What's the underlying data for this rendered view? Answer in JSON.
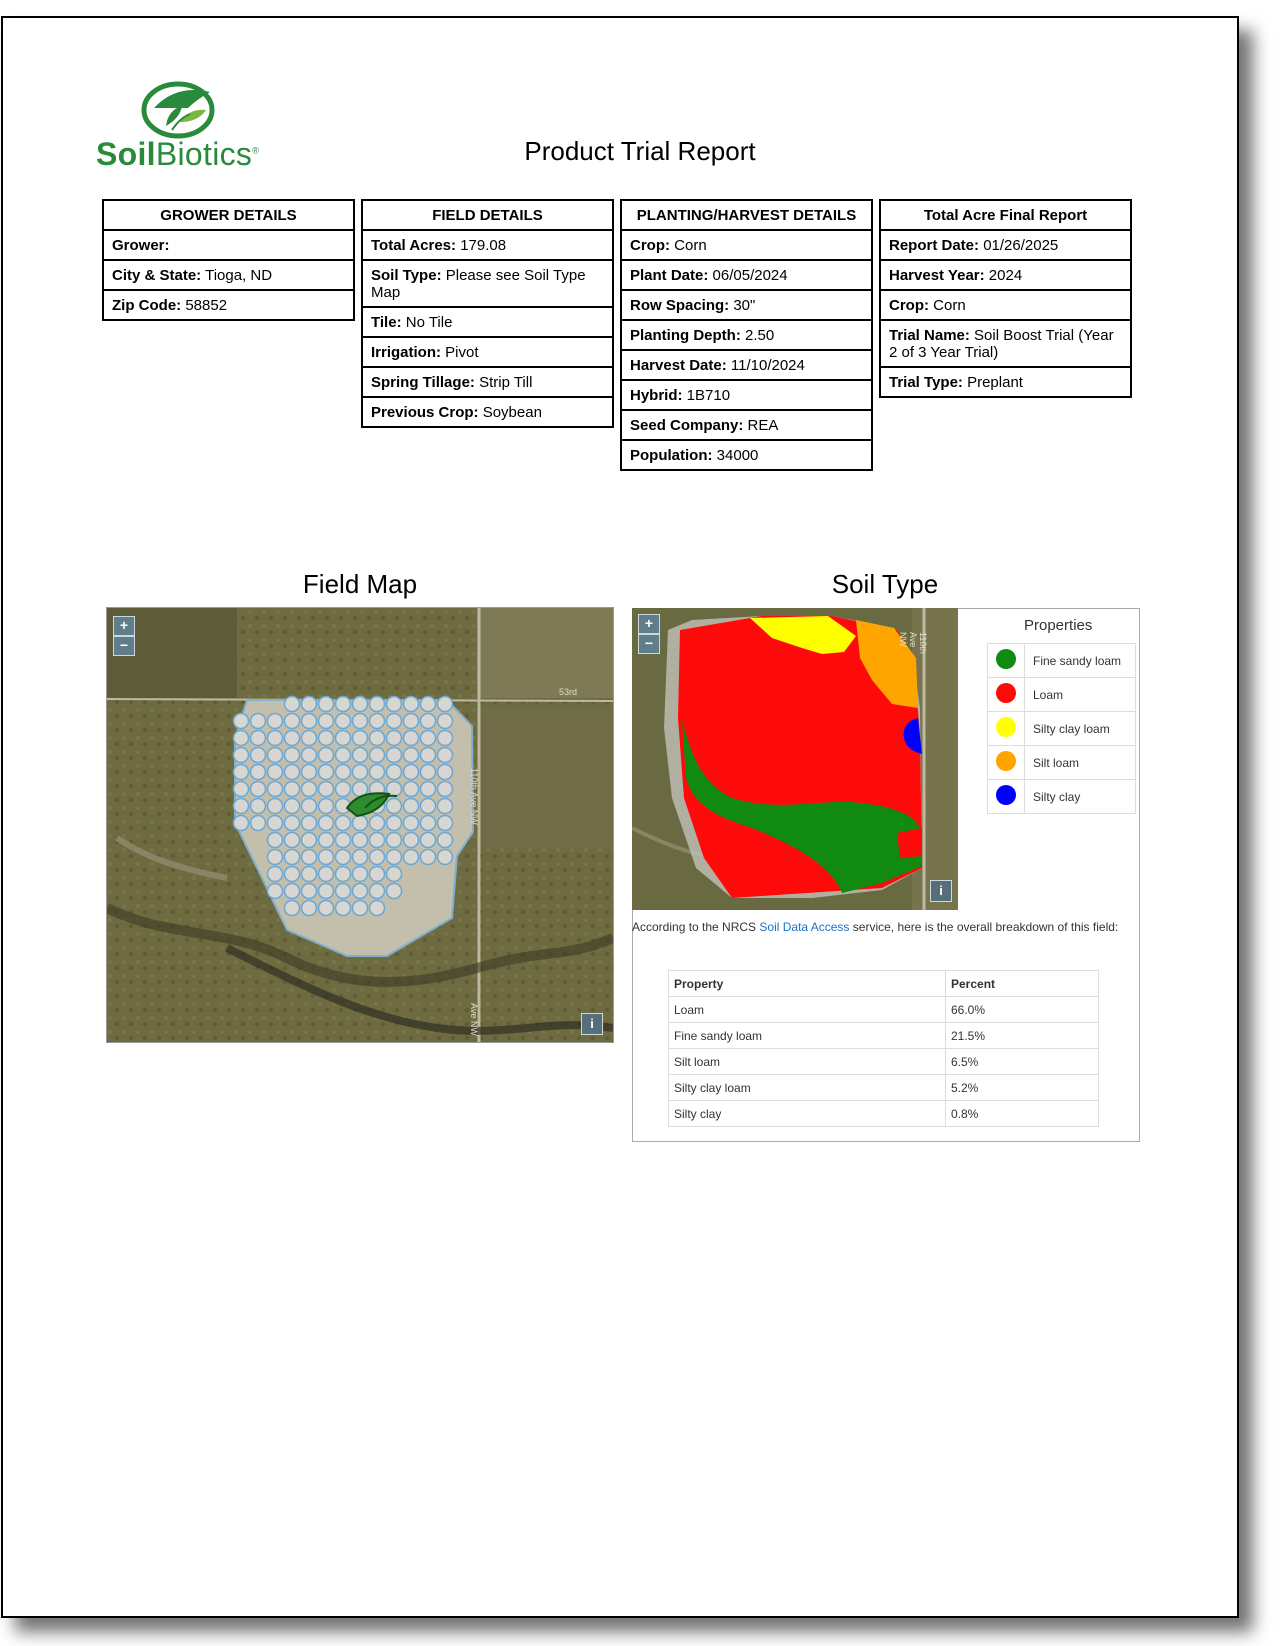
{
  "logo": {
    "text_bold": "Soil",
    "text_light": "Biotics",
    "mark": "®"
  },
  "report_title": "Product Trial Report",
  "grower": {
    "header": "GROWER DETAILS",
    "rows": [
      {
        "label": "Grower:",
        "value": ""
      },
      {
        "label": "City & State:",
        "value": "Tioga, ND"
      },
      {
        "label": "Zip Code:",
        "value": "58852"
      }
    ]
  },
  "field": {
    "header": "FIELD DETAILS",
    "rows": [
      {
        "label": "Total Acres:",
        "value": "179.08"
      },
      {
        "label": "Soil Type:",
        "value": "Please see Soil Type Map"
      },
      {
        "label": "Tile:",
        "value": "No Tile"
      },
      {
        "label": "Irrigation:",
        "value": "Pivot"
      },
      {
        "label": "Spring Tillage:",
        "value": "Strip Till"
      },
      {
        "label": "Previous Crop:",
        "value": "Soybean"
      }
    ]
  },
  "planting": {
    "header": "PLANTING/HARVEST DETAILS",
    "rows": [
      {
        "label": "Crop:",
        "value": "Corn"
      },
      {
        "label": "Plant Date:",
        "value": "06/05/2024"
      },
      {
        "label": "Row Spacing:",
        "value": "30\""
      },
      {
        "label": "Planting Depth:",
        "value": "2.50"
      },
      {
        "label": "Harvest Date:",
        "value": "11/10/2024"
      },
      {
        "label": "Hybrid:",
        "value": " 1B710"
      },
      {
        "label": "Seed Company:",
        "value": " REA"
      },
      {
        "label": "Population:",
        "value": " 34000"
      }
    ]
  },
  "final": {
    "header": "Total Acre Final Report",
    "rows": [
      {
        "label": "Report Date:",
        "value": "01/26/2025"
      },
      {
        "label": "Harvest Year:",
        "value": "2024"
      },
      {
        "label": "Crop:",
        "value": "Corn"
      },
      {
        "label": "Trial Name:",
        "value": "Soil Boost Trial (Year 2 of 3 Year Trial)"
      },
      {
        "label": "Trial Type:",
        "value": "Preplant"
      }
    ]
  },
  "field_map": {
    "title": "Field Map",
    "zoom_in": "+",
    "zoom_out": "−",
    "info": "i",
    "road_labels": [
      "53rd",
      "110th Ave NW",
      "Ave NW"
    ]
  },
  "soil_type": {
    "title": "Soil Type",
    "zoom_in": "+",
    "zoom_out": "−",
    "info": "i",
    "road_label": "110th Ave NW",
    "legend_title": "Properties",
    "legend": [
      {
        "label": "Fine sandy loam",
        "color": "#118a11"
      },
      {
        "label": "Loam",
        "color": "#ff0a0a"
      },
      {
        "label": "Silty clay loam",
        "color": "#ffff00"
      },
      {
        "label": "Silt loam",
        "color": "#ffa500"
      },
      {
        "label": "Silty clay",
        "color": "#0000ff"
      }
    ],
    "note_prefix": "According to the NRCS ",
    "note_link": "Soil Data Access",
    "note_suffix": " service, here is the overall breakdown of this field:",
    "table_headers": [
      "Property",
      "Percent"
    ],
    "table_rows": [
      [
        "Loam",
        "66.0%"
      ],
      [
        "Fine sandy loam",
        "21.5%"
      ],
      [
        "Silt loam",
        "6.5%"
      ],
      [
        "Silty clay loam",
        "5.2%"
      ],
      [
        "Silty clay",
        "0.8%"
      ]
    ]
  }
}
